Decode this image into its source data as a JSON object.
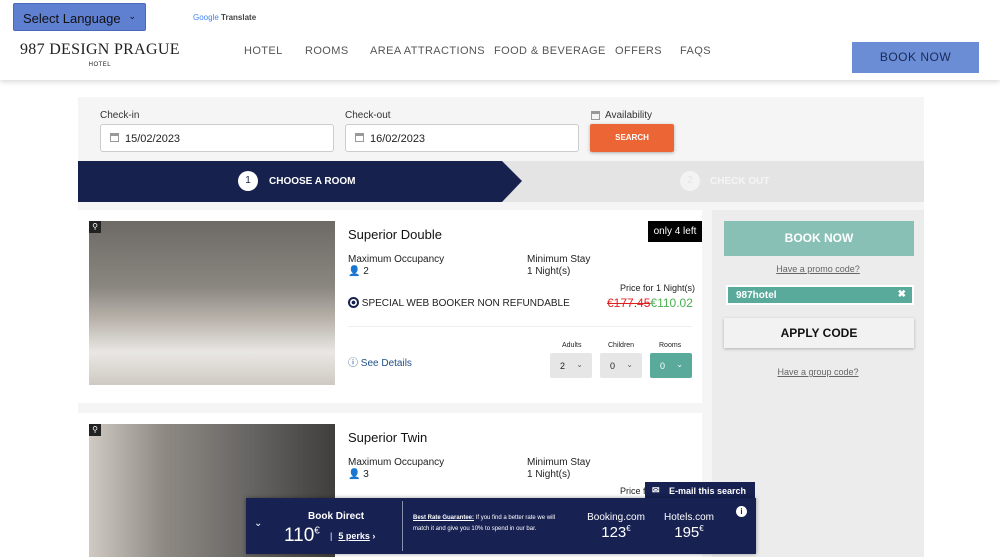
{
  "header": {
    "language_select": "Select Language",
    "google_translate": {
      "brand": "Google",
      "label": "Translate"
    },
    "logo": {
      "name": "987 DESIGN PRAGUE",
      "sub": "HOTEL"
    },
    "nav": [
      "HOTEL",
      "ROOMS",
      "AREA ATTRACTIONS",
      "FOOD & BEVERAGE",
      "OFFERS",
      "FAQS"
    ],
    "book_now": "BOOK NOW"
  },
  "search": {
    "checkin_label": "Check-in",
    "checkin": "15/02/2023",
    "checkout_label": "Check-out",
    "checkout": "16/02/2023",
    "availability_label": "Availability",
    "search_button": "SEARCH"
  },
  "steps": [
    {
      "num": "1",
      "label": "CHOOSE A ROOM"
    },
    {
      "num": "2",
      "label": "CHECK OUT"
    }
  ],
  "rooms": [
    {
      "name": "Superior Double",
      "badge": "only 4 left",
      "occupancy_label": "Maximum Occupancy",
      "occupancy": "2",
      "stay_label": "Minimum Stay",
      "stay": "1 Night(s)",
      "price_for": "Price for 1 Night(s)",
      "rate": "SPECIAL WEB BOOKER NON REFUNDABLE",
      "old_price": "€177.45",
      "price": "€110.02",
      "details": "See Details",
      "adults_label": "Adults",
      "adults": "2",
      "children_label": "Children",
      "children": "0",
      "rooms_label": "Rooms",
      "rooms": "0"
    },
    {
      "name": "Superior Twin",
      "occupancy_label": "Maximum Occupancy",
      "occupancy": "3",
      "stay_label": "Minimum Stay",
      "stay": "1 Night(s)",
      "price_for": "Price f"
    }
  ],
  "sidebar": {
    "book_now": "BOOK NOW",
    "promo_link": "Have a promo code?",
    "promo_code": "987hotel",
    "apply": "APPLY CODE",
    "group_link": "Have a group code?"
  },
  "compare_bar": {
    "email": "E-mail this search",
    "direct_label": "Book Direct",
    "direct_price": "110",
    "currency": "€",
    "perks": "5 perks",
    "guarantee_title": "Best Rate Guarantee:",
    "guarantee_text": " If you find a better rate we will match it and give you 10% to spend in our bar.",
    "competitors": [
      {
        "name": "Booking.com",
        "price": "123"
      },
      {
        "name": "Hotels.com",
        "price": "195"
      }
    ]
  },
  "colors": {
    "navy": "#16224d",
    "orange": "#ec6535",
    "teal": "#5aaa9c",
    "nav_blue": "#6b8dd6"
  }
}
